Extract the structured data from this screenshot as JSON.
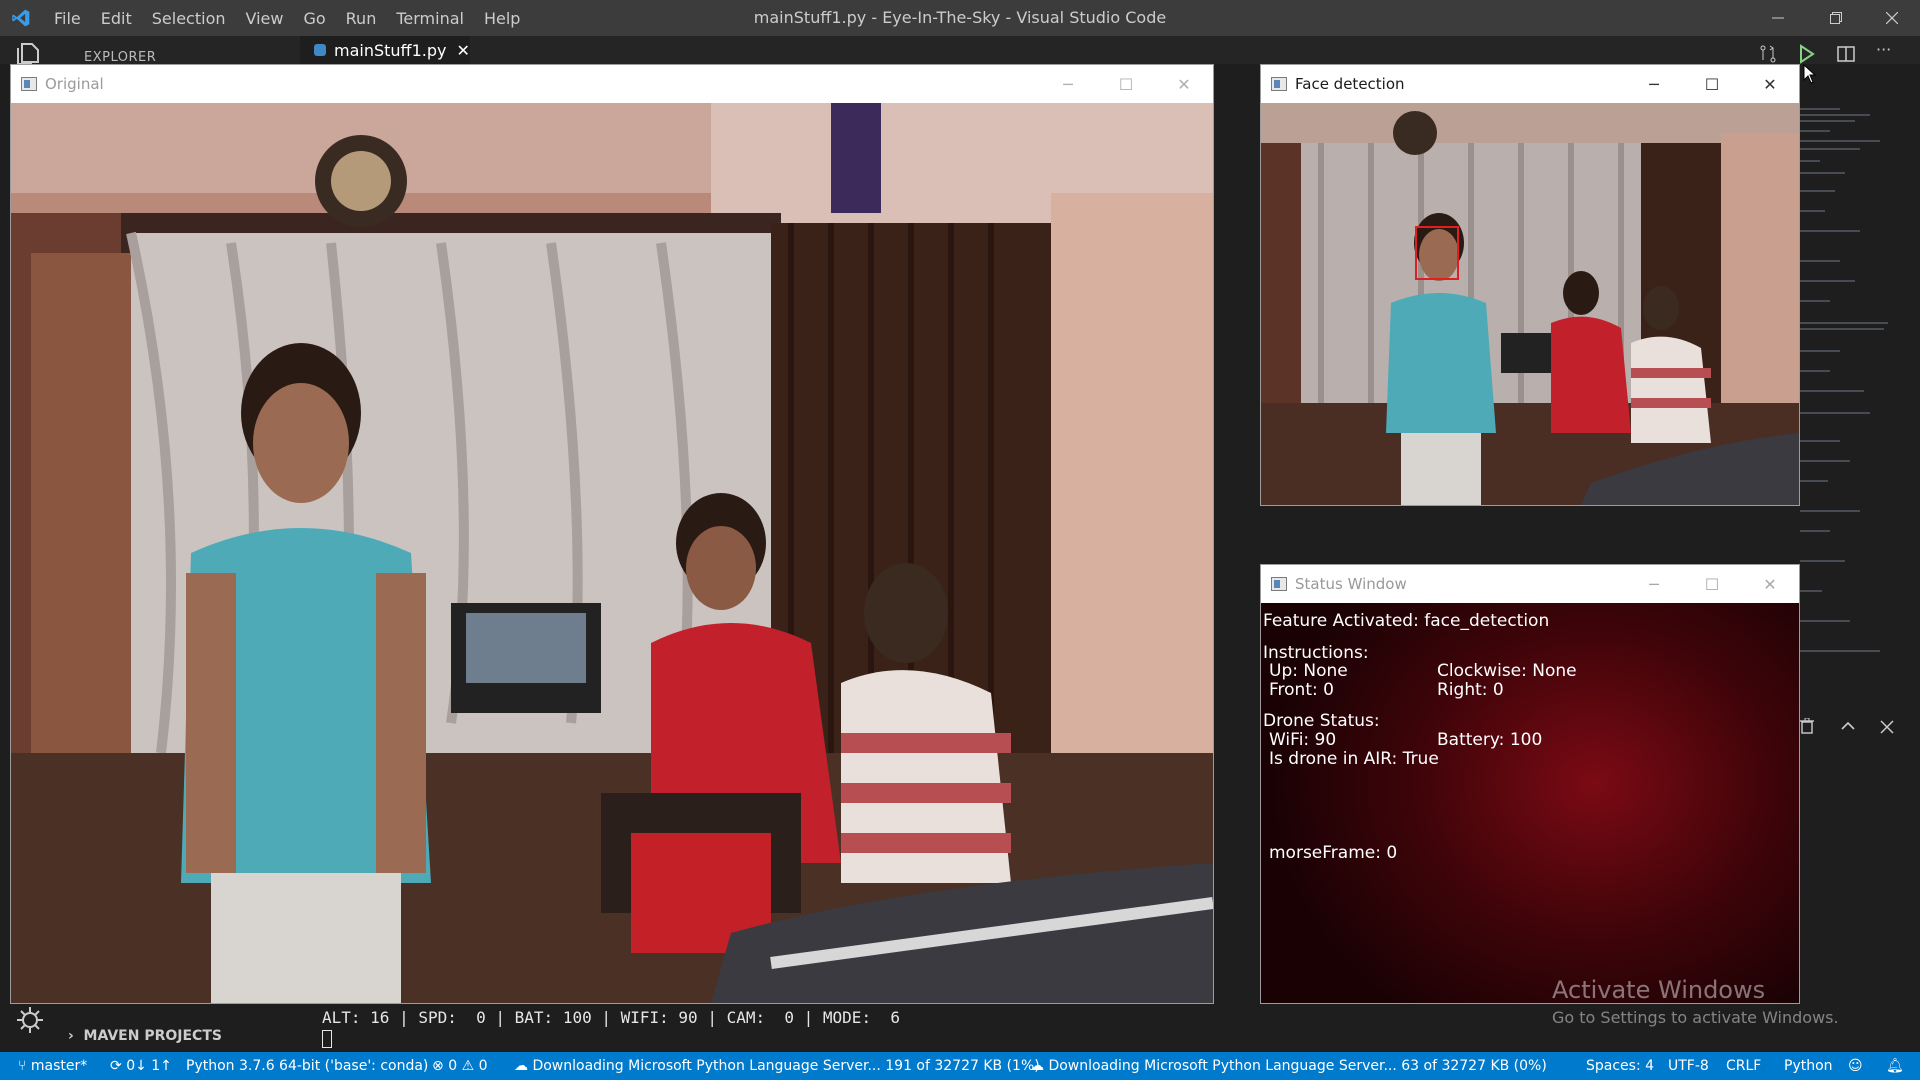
{
  "vscode": {
    "menu": [
      "File",
      "Edit",
      "Selection",
      "View",
      "Go",
      "Run",
      "Terminal",
      "Help"
    ],
    "window_title": "mainStuff1.py - Eye-In-The-Sky - Visual Studio Code",
    "explorer_label": "EXPLORER",
    "active_tab": "mainStuff1.py",
    "maven_label": "MAVEN PROJECTS",
    "terminal_line": "ALT: 16 | SPD:  0 | BAT: 100 | WIFI: 90 | CAM:  0 | MODE:  6"
  },
  "windows": {
    "original": {
      "title": "Original"
    },
    "face_detection": {
      "title": "Face detection"
    },
    "status": {
      "title": "Status Window",
      "feature": "Feature Activated: face_detection",
      "instructions_header": "Instructions:",
      "up": "Up: None",
      "clockwise": "Clockwise: None",
      "front": "Front: 0",
      "right": "Right: 0",
      "drone_status_header": "Drone Status:",
      "wifi": "WiFi: 90",
      "battery": "Battery: 100",
      "in_air": "Is drone in AIR: True",
      "morse": "morseFrame: 0"
    }
  },
  "watermark": {
    "title": "Activate Windows",
    "subtitle": "Go to Settings to activate Windows."
  },
  "statusbar": {
    "branch": "master*",
    "sync": "0↓ 1↑",
    "python": "Python 3.7.6 64-bit ('base': conda)",
    "errors": "0",
    "warnings": "0",
    "download1": "Downloading Microsoft Python Language Server... 191 of 32727 KB (1%)",
    "download2": "Downloading Microsoft Python Language Server... 63 of 32727 KB (0%)",
    "spaces": "Spaces: 4",
    "encoding": "UTF-8",
    "eol": "CRLF",
    "language": "Python"
  },
  "colors": {
    "statusbar": "#007acc",
    "titlebar": "#3c3c3c",
    "editor_bg": "#1e1e1e",
    "face_box": "#e02020"
  }
}
